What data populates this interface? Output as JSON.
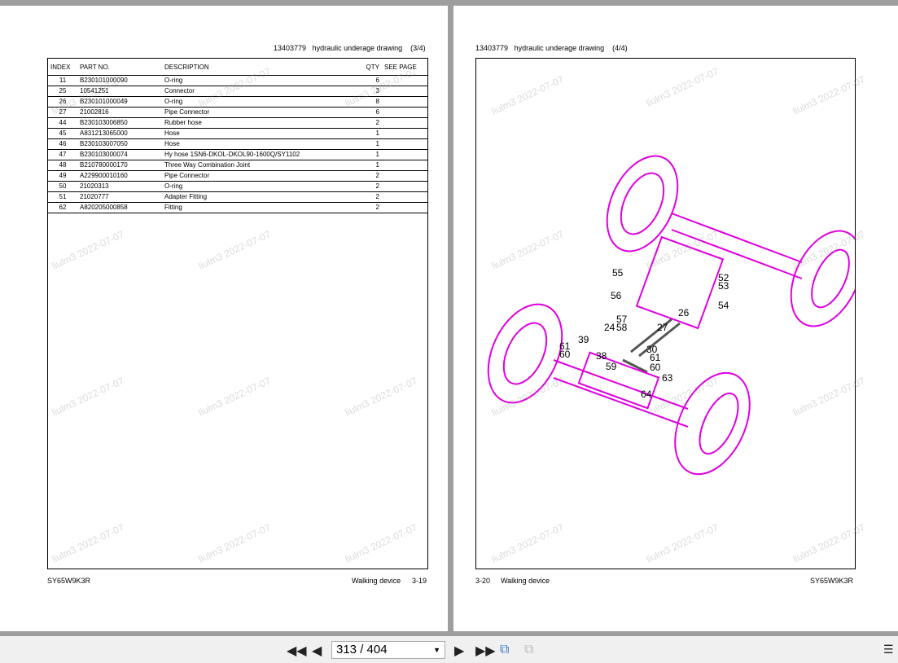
{
  "left_page": {
    "header": {
      "doc_no": "13403779",
      "title": "hydraulic underage drawing",
      "part": "(3/4)"
    },
    "columns": [
      "INDEX",
      "PART NO.",
      "DESCRIPTION",
      "QTY",
      "SEE PAGE"
    ],
    "rows": [
      [
        "11",
        "B230101000090",
        "O-ring",
        "6"
      ],
      [
        "25",
        "10541251",
        "Connector",
        "3"
      ],
      [
        "26",
        "B230101000049",
        "O-ring",
        "8"
      ],
      [
        "27",
        "21002816",
        "Pipe Connector",
        "6"
      ],
      [
        "44",
        "B230103006850",
        "Rubber hose",
        "2"
      ],
      [
        "45",
        "A831213065000",
        "Hose",
        "1"
      ],
      [
        "46",
        "B230103007050",
        "Hose",
        "1"
      ],
      [
        "47",
        "B230103000074",
        "Hy hose 1SN6-DKOL-DKOL90-1600Q/SY1102",
        "1"
      ],
      [
        "48",
        "B210780000170",
        "Three Way Combination Joint",
        "1"
      ],
      [
        "49",
        "A229900010160",
        "Pipe Connector",
        "2"
      ],
      [
        "50",
        "21020313",
        "O-ring",
        "2"
      ],
      [
        "51",
        "21020777",
        "Adapter Fitting",
        "2"
      ],
      [
        "62",
        "A820205000858",
        "Fitting",
        "2"
      ]
    ],
    "footer": {
      "model": "SY65W9K3R",
      "section": "Walking device",
      "page": "3-19"
    }
  },
  "right_page": {
    "header": {
      "doc_no": "13403779",
      "title": "hydraulic underage drawing",
      "part": "(4/4)"
    },
    "callouts": [
      "55",
      "52",
      "53",
      "56",
      "54",
      "57",
      "24",
      "58",
      "27",
      "26",
      "39",
      "61",
      "60",
      "38",
      "30",
      "61",
      "60",
      "59",
      "63",
      "64"
    ],
    "drawing_color": "#e000e0",
    "footer": {
      "page": "3-20",
      "section": "Walking device",
      "model": "SY65W9K3R"
    }
  },
  "watermark": "liulm3 2022-07-07",
  "toolbar": {
    "page_indicator": "313 / 404"
  }
}
